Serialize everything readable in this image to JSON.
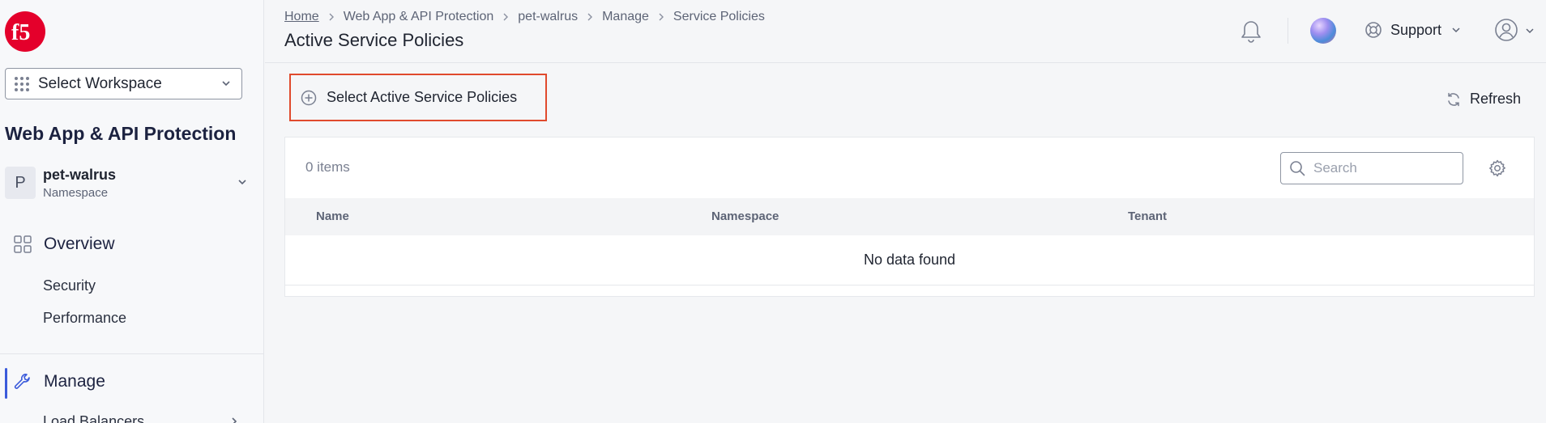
{
  "brand": {
    "logo_icon": "f5-logo-icon",
    "logo_text": "f5",
    "color": "#e4002b"
  },
  "workspace": {
    "label": "Select Workspace",
    "icon": "grid-dots-icon"
  },
  "app": {
    "title": "Web App & API Protection"
  },
  "namespace": {
    "avatar": "P",
    "name": "pet-walrus",
    "type": "Namespace"
  },
  "nav": {
    "overview": {
      "label": "Overview",
      "icon": "dashboard-grid-icon"
    },
    "security": "Security",
    "performance": "Performance",
    "manage": {
      "label": "Manage",
      "icon": "wrench-icon"
    },
    "load_balancers": "Load Balancers"
  },
  "breadcrumb": [
    "Home",
    "Web App & API Protection",
    "pet-walrus",
    "Manage",
    "Service Policies"
  ],
  "page": {
    "title": "Active Service Policies"
  },
  "header": {
    "support_label": "Support"
  },
  "actions": {
    "select_label": "Select Active Service Policies",
    "refresh_label": "Refresh"
  },
  "table": {
    "count_label": "0 items",
    "search_placeholder": "Search",
    "columns": [
      "Name",
      "Namespace",
      "Tenant"
    ],
    "empty_message": "No data found"
  },
  "colors": {
    "highlight_border": "#e04a2d",
    "active_nav": "#3b5bdb"
  }
}
